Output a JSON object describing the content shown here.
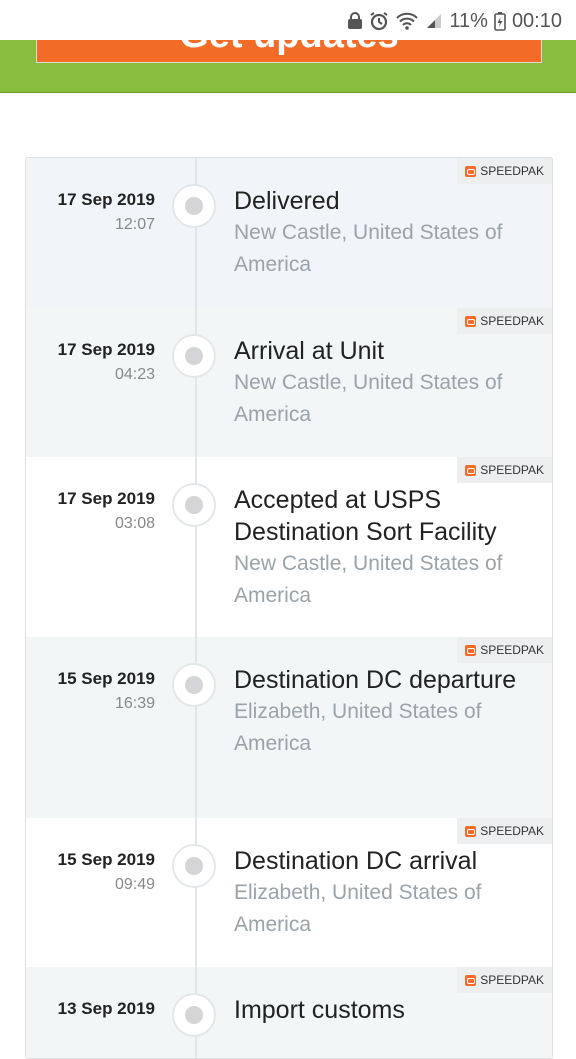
{
  "status_bar": {
    "battery_percent": "11%",
    "time": "00:10"
  },
  "banner": {
    "button_label": "Get updates",
    "colors": {
      "background": "#88bd3f",
      "button": "#f26c27"
    }
  },
  "events": [
    {
      "date": "17 Sep 2019",
      "time": "12:07",
      "status": "Delivered",
      "location": "New Castle, United States of America",
      "carrier": "SPEEDPAK"
    },
    {
      "date": "17 Sep 2019",
      "time": "04:23",
      "status": "Arrival at Unit",
      "location": "New Castle, United States of America",
      "carrier": "SPEEDPAK"
    },
    {
      "date": "17 Sep 2019",
      "time": "03:08",
      "status": "Accepted at USPS Destination Sort Facility",
      "location": "New Castle, United States of America",
      "carrier": "SPEEDPAK"
    },
    {
      "date": "15 Sep 2019",
      "time": "16:39",
      "status": "Destination DC departure",
      "location": "Elizabeth, United States of America",
      "carrier": "SPEEDPAK"
    },
    {
      "date": "15 Sep 2019",
      "time": "09:49",
      "status": "Destination DC arrival",
      "location": "Elizabeth, United States of America",
      "carrier": "SPEEDPAK"
    },
    {
      "date": "13 Sep 2019",
      "time": "",
      "status": "Import customs",
      "location": "",
      "carrier": "SPEEDPAK"
    }
  ]
}
